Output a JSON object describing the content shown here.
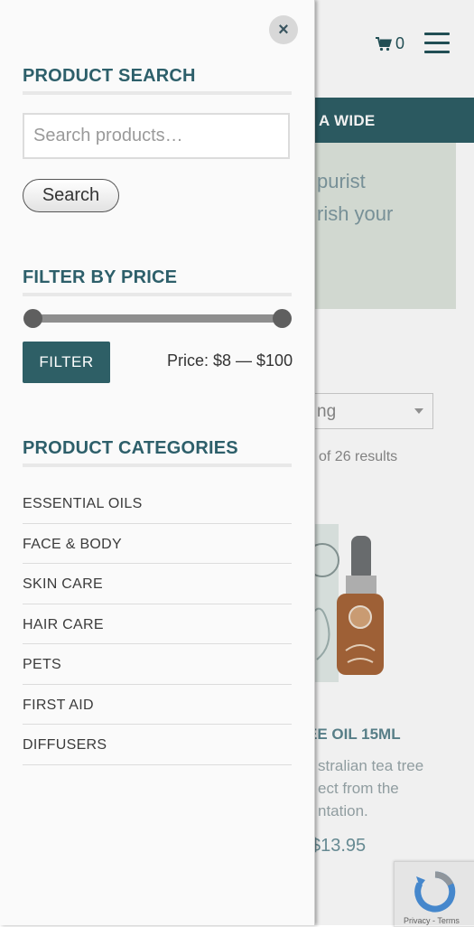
{
  "background_page": {
    "cart_count": "0",
    "banner_text": "A WIDE",
    "hero_line_1": "purist",
    "hero_line_2": "rish your",
    "sort_value": "ng",
    "results_text": "of 26 results",
    "product_name": "EE OIL 15ML",
    "product_desc_1": "stralian tea tree",
    "product_desc_2": "ect from the",
    "product_desc_3": "ntation.",
    "product_price": "$13.95",
    "recaptcha_text": "Privacy - Terms"
  },
  "panel": {
    "close_label": "×",
    "search_widget": {
      "title": "PRODUCT SEARCH",
      "placeholder": "Search products…",
      "value": "",
      "button_label": "Search"
    },
    "price_widget": {
      "title": "FILTER BY PRICE",
      "button_label": "FILTER",
      "price_label": "Price: $8 — $100",
      "min_fraction": 0,
      "max_fraction": 1
    },
    "categories_widget": {
      "title": "PRODUCT CATEGORIES",
      "items": [
        {
          "label": "ESSENTIAL OILS"
        },
        {
          "label": "FACE & BODY"
        },
        {
          "label": "SKIN CARE"
        },
        {
          "label": "HAIR CARE"
        },
        {
          "label": "PETS"
        },
        {
          "label": "FIRST AID"
        },
        {
          "label": "DIFFUSERS"
        }
      ]
    }
  },
  "colors": {
    "brand": "#2e5f66",
    "title": "#2d5f6a",
    "panel_bg": "#fafafa"
  },
  "icons": [
    "cart-icon",
    "hamburger-icon",
    "close-icon",
    "recaptcha-icon"
  ]
}
